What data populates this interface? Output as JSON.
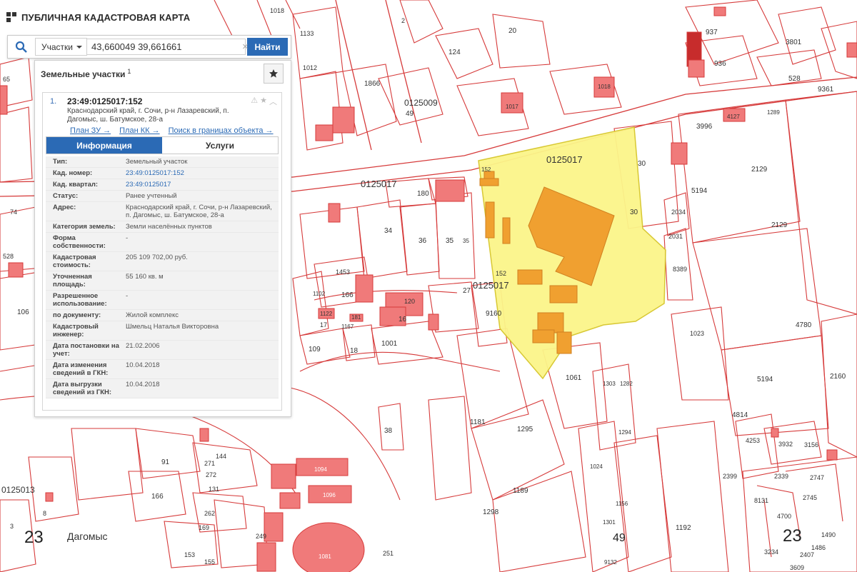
{
  "app": {
    "title": "ПУБЛИЧНАЯ КАДАСТРОВАЯ КАРТА"
  },
  "search": {
    "type_label": "Участки",
    "query": "43,660049 39,661661",
    "find_label": "Найти"
  },
  "panel": {
    "title": "Земельные участки",
    "count": "1",
    "result": {
      "number": "1.",
      "cad_id": "23:49:0125017:152",
      "address": "Краснодарский край, г. Сочи, р-н Лазаревский, п. Дагомыс, ш. Батумское, 28-а",
      "links": [
        "План ЗУ →",
        "План КК →",
        "Поиск в границах объекта →"
      ],
      "tabs": [
        "Информация",
        "Услуги"
      ],
      "props": [
        {
          "label": "Тип:",
          "value": "Земельный участок"
        },
        {
          "label": "Кад. номер:",
          "value": "23:49:0125017:152"
        },
        {
          "label": "Кад. квартал:",
          "value": "23:49:0125017"
        },
        {
          "label": "Статус:",
          "value": "Ранее учтенный"
        },
        {
          "label": "Адрес:",
          "value": "Краснодарский край, г. Сочи, р-н Лазаревский, п. Дагомыс, ш. Батумское, 28-а"
        },
        {
          "label": "Категория земель:",
          "value": "Земли населённых пунктов"
        },
        {
          "label": "Форма собственности:",
          "value": "-"
        },
        {
          "label": "Кадастровая стоимость:",
          "value": "205 109 702,00 руб."
        },
        {
          "label": "Уточненная площадь:",
          "value": "55 160 кв. м"
        },
        {
          "label": "Разрешенное использование:",
          "value": "-"
        },
        {
          "label": "по документу:",
          "value": "Жилой комплекс"
        },
        {
          "label": "Кадастровый инженер:",
          "value": "Шмельц Наталья Викторовна"
        },
        {
          "label": "Дата постановки на учет:",
          "value": "21.02.2006"
        },
        {
          "label": "Дата изменения сведений в ГКН:",
          "value": "10.04.2018"
        },
        {
          "label": "Дата выгрузки сведений из ГКН:",
          "value": "10.04.2018"
        }
      ]
    }
  },
  "map": {
    "colors": {
      "boundary": "#d63a3a",
      "building_fill": "#f07a7a",
      "selected_fill": "#fbf58a",
      "selected_building": "#f0a030",
      "background": "#ffffff"
    },
    "labels": {
      "q1": "0125017",
      "q2": "0125017",
      "q3": "0125017",
      "q4": "0125009",
      "q5": "0125013",
      "p20": "20",
      "p124": "124",
      "p1018a": "1018",
      "p1017": "1017",
      "p49": "49",
      "p1866": "1866",
      "p528": "528",
      "p9361": "9361",
      "p3996": "3996",
      "p3801": "3801",
      "p937": "937",
      "p936": "936",
      "p4127": "4127",
      "p1289": "1289",
      "p2129a": "2129",
      "p2129b": "2129",
      "p5194a": "5194",
      "p5194b": "5194",
      "p2034": "2034",
      "p2031": "2031",
      "p8389": "8389",
      "p30a": "30",
      "p30b": "30",
      "p4780": "4780",
      "p1023": "1023",
      "p4814": "4814",
      "p2160": "2160",
      "p4253": "4253",
      "p3932": "3932",
      "p3156": "3156",
      "p2399": "2399",
      "p2339": "2339",
      "p2747": "2747",
      "p2745": "2745",
      "p8131": "8131",
      "p4700": "4700",
      "p1490": "1490",
      "p1486": "1486",
      "p3234": "3234",
      "p2407": "2407",
      "p3609": "3609",
      "p1061": "1061",
      "p1303": "1303",
      "p1282": "1282",
      "p1294": "1294",
      "p1181": "1181",
      "p1295": "1295",
      "p1189": "1189",
      "p1298": "1298",
      "p1024": "1024",
      "p1156": "1156",
      "p1301": "1301",
      "p9132": "9132",
      "p1192": "1192",
      "p9160": "9160",
      "p27": "27",
      "p35a": "35",
      "p35b": "35",
      "p36": "36",
      "p34": "34",
      "p180": "180",
      "p152a": "152",
      "p152b": "152",
      "p1453": "1453",
      "p166a": "166",
      "p1102": "1102",
      "p1122": "1122",
      "p181": "181",
      "p17": "17",
      "p1167": "1167",
      "p16": "16",
      "p120": "120",
      "p109": "109",
      "p18": "18",
      "p1001": "1001",
      "p38": "38",
      "p91": "91",
      "p144": "144",
      "p271": "271",
      "p272": "272",
      "p131": "131",
      "p166b": "166",
      "p262": "262",
      "p169": "169",
      "p155": "155",
      "p153": "153",
      "p249": "249",
      "p251": "251",
      "p1081": "1081",
      "p1094": "1094",
      "p1096": "1096",
      "p106": "106",
      "p528b": "528",
      "p74": "74",
      "p65": "65",
      "p3": "3",
      "p8": "8",
      "p1012": "1012",
      "p1133": "1133",
      "p2": "2",
      "p1018b": "1018",
      "n23a": "23",
      "n23b": "23",
      "n49": "49",
      "town": "Дагомыс"
    }
  }
}
